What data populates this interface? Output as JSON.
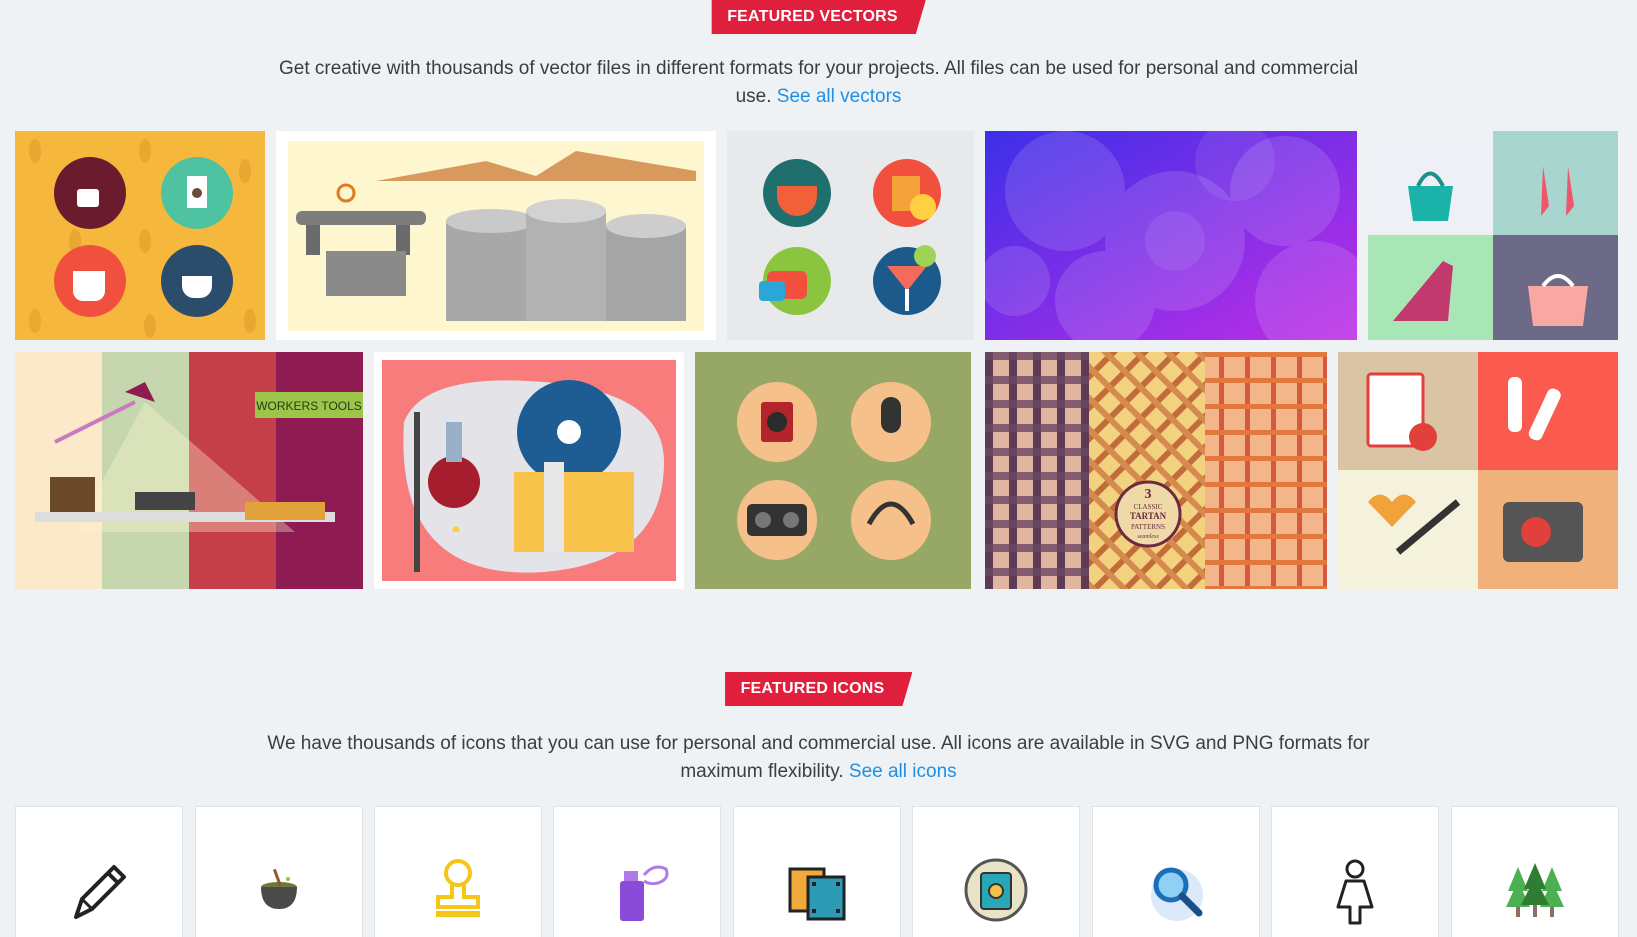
{
  "vectors_section": {
    "tag": "FEATURED VECTORS",
    "description": "Get creative with thousands of vector files in different formats for your projects. All files can be used for personal and commercial use.",
    "link": "See all vectors"
  },
  "vector_tiles": [
    {
      "name": "coffee-icons-vector",
      "bg": "#f5b83d"
    },
    {
      "name": "pipeline-industrial-vector",
      "bg": "#fdf6cf"
    },
    {
      "name": "drinks-icons-vector",
      "bg": "#e8e9eb"
    },
    {
      "name": "purple-bokeh-background",
      "bg": "#6b2af0"
    },
    {
      "name": "fashion-accessories-vector",
      "bg": "#a9d5cf"
    },
    {
      "name": "workers-tools-vector",
      "bg": "#fbe9c9",
      "label": "WORKERS TOOLS"
    },
    {
      "name": "laboratory-vector",
      "bg": "#f87c7b"
    },
    {
      "name": "audio-icons-vector",
      "bg": "#97a866"
    },
    {
      "name": "tartan-patterns-vector",
      "bg": "#e8b57a",
      "badge_lines": [
        "3",
        "CLASSIC",
        "TARTAN",
        "PATTERNS",
        "seamless"
      ]
    },
    {
      "name": "medical-icons-vector",
      "bg": "#fb5a4f"
    }
  ],
  "icons_section": {
    "tag": "FEATURED ICONS",
    "description": "We have thousands of icons that you can use for personal and commercial use. All icons are available in SVG and PNG formats for maximum flexibility.",
    "link": "See all icons"
  },
  "icon_cards": [
    {
      "icon": "pencil-icon"
    },
    {
      "icon": "cauldron-icon"
    },
    {
      "icon": "stamp-icon"
    },
    {
      "icon": "spray-can-icon"
    },
    {
      "icon": "film-strip-icon"
    },
    {
      "icon": "safe-icon"
    },
    {
      "icon": "magnifier-icon"
    },
    {
      "icon": "woman-icon"
    },
    {
      "icon": "trees-icon"
    }
  ]
}
